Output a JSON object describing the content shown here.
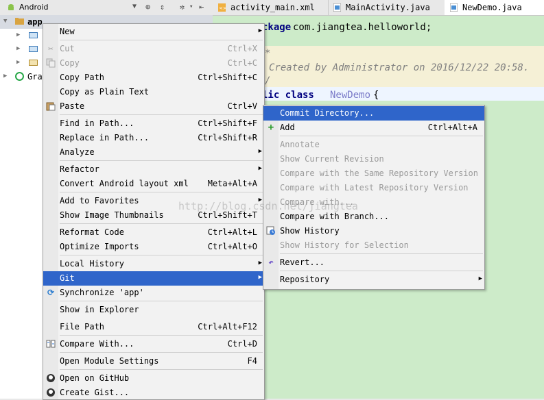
{
  "project_panel": {
    "view_selector": "Android",
    "tree": [
      {
        "label": "app",
        "expanded": true
      },
      {
        "label": "",
        "type": "folder"
      },
      {
        "label": "",
        "type": "folder"
      },
      {
        "label": "",
        "type": "folder"
      },
      {
        "label": "Gra",
        "type": "gradle"
      }
    ]
  },
  "editor": {
    "tabs": [
      {
        "label": "activity_main.xml",
        "icon": "xml-file-icon"
      },
      {
        "label": "MainActivity.java",
        "icon": "java-class-icon"
      },
      {
        "label": "NewDemo.java",
        "icon": "java-class-icon",
        "active": true
      }
    ],
    "code": {
      "line1_kw": "ckage",
      "line1_rest": " com.jiangtea.helloworld;",
      "comment_open": "*",
      "comment_text": "Created by Administrator on 2016/12/22 20:58.",
      "comment_close": "/",
      "class_kw": "lic class ",
      "class_name": "NewDemo",
      "class_brace": " {"
    }
  },
  "context_menu": {
    "items": [
      {
        "label": "New",
        "submenu": true
      },
      {
        "label": "Cut",
        "shortcut": "Ctrl+X",
        "icon": "scissors-icon",
        "disabled": true
      },
      {
        "label": "Copy",
        "shortcut": "Ctrl+C",
        "icon": "copy-icon",
        "disabled": true
      },
      {
        "label": "Copy Path",
        "shortcut": "Ctrl+Shift+C"
      },
      {
        "label": "Copy as Plain Text"
      },
      {
        "label": "Paste",
        "shortcut": "Ctrl+V",
        "icon": "paste-icon"
      },
      {
        "label": "Find in Path...",
        "shortcut": "Ctrl+Shift+F"
      },
      {
        "label": "Replace in Path...",
        "shortcut": "Ctrl+Shift+R"
      },
      {
        "label": "Analyze",
        "submenu": true
      },
      {
        "label": "Refactor",
        "submenu": true
      },
      {
        "label": "Convert Android layout xml",
        "shortcut": "Meta+Alt+A"
      },
      {
        "label": "Add to Favorites",
        "submenu": true
      },
      {
        "label": "Show Image Thumbnails",
        "shortcut": "Ctrl+Shift+T"
      },
      {
        "label": "Reformat Code",
        "shortcut": "Ctrl+Alt+L"
      },
      {
        "label": "Optimize Imports",
        "shortcut": "Ctrl+Alt+O"
      },
      {
        "label": "Local History",
        "submenu": true
      },
      {
        "label": "Git",
        "submenu": true,
        "selected": true
      },
      {
        "label": "Synchronize 'app'",
        "icon": "sync-icon"
      },
      {
        "label": "Show in Explorer"
      },
      {
        "label": "File Path",
        "shortcut": "Ctrl+Alt+F12"
      },
      {
        "label": "Compare With...",
        "shortcut": "Ctrl+D",
        "icon": "compare-icon"
      },
      {
        "label": "Open Module Settings",
        "shortcut": "F4"
      },
      {
        "label": "Open on GitHub",
        "icon": "github-icon"
      },
      {
        "label": "Create Gist...",
        "icon": "github-icon"
      }
    ]
  },
  "git_submenu": {
    "items": [
      {
        "label": "Commit Directory...",
        "selected": true
      },
      {
        "label": "Add",
        "shortcut": "Ctrl+Alt+A",
        "icon": "plus-icon"
      },
      {
        "label": "Annotate",
        "disabled": true
      },
      {
        "label": "Show Current Revision",
        "disabled": true
      },
      {
        "label": "Compare with the Same Repository Version",
        "disabled": true
      },
      {
        "label": "Compare with Latest Repository Version",
        "disabled": true
      },
      {
        "label": "Compare with...",
        "disabled": true
      },
      {
        "label": "Compare with Branch..."
      },
      {
        "label": "Show History",
        "icon": "history-icon"
      },
      {
        "label": "Show History for Selection",
        "disabled": true
      },
      {
        "label": "Revert...",
        "icon": "revert-icon"
      },
      {
        "label": "Repository",
        "submenu": true
      }
    ]
  },
  "watermark": "http://blog.csdn.net/jiangtea",
  "colors": {
    "menu_selection": "#2f65ca",
    "editor_background": "#cdebc9",
    "keyword": "#000080",
    "comment": "#808080"
  }
}
